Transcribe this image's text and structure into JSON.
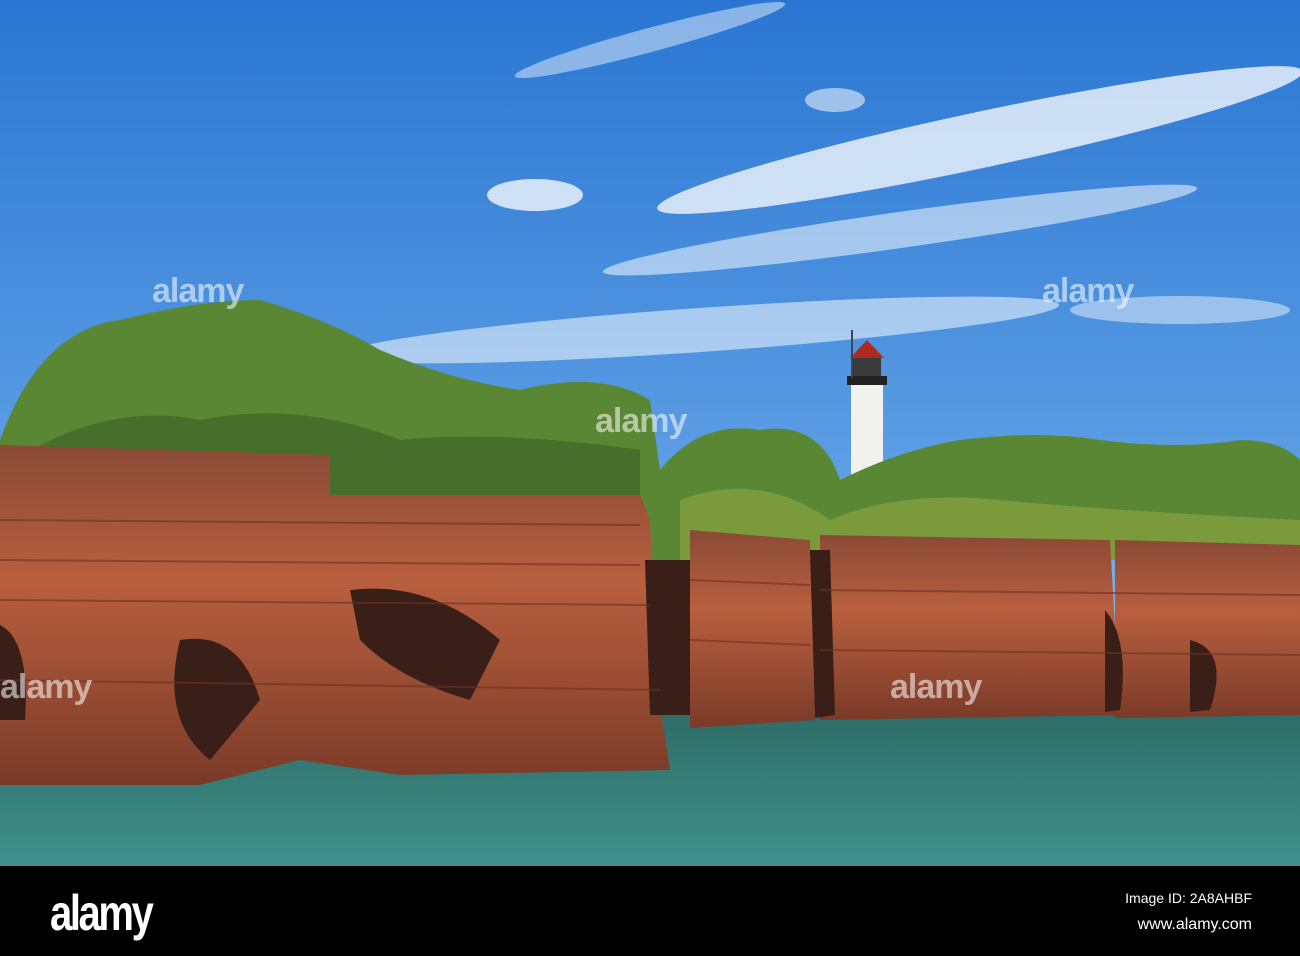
{
  "photo": {
    "subject": "Sandstone sea cliffs with lighthouse",
    "colors": {
      "sky_top": "#2f7fd6",
      "sky_bottom": "#7fb6ea",
      "water": "#3e8a85",
      "rock": "#a8553a",
      "rock_dark": "#5a2e22",
      "foliage": "#5f8a36",
      "lighthouse": "#f2f2f0",
      "lantern_roof": "#b02a20"
    }
  },
  "watermark": {
    "logo": "alamy",
    "repeat_text": "alamy"
  },
  "footer": {
    "logo": "alamy",
    "image_id": "Image ID: 2A8AHBF",
    "website": "www.alamy.com"
  }
}
